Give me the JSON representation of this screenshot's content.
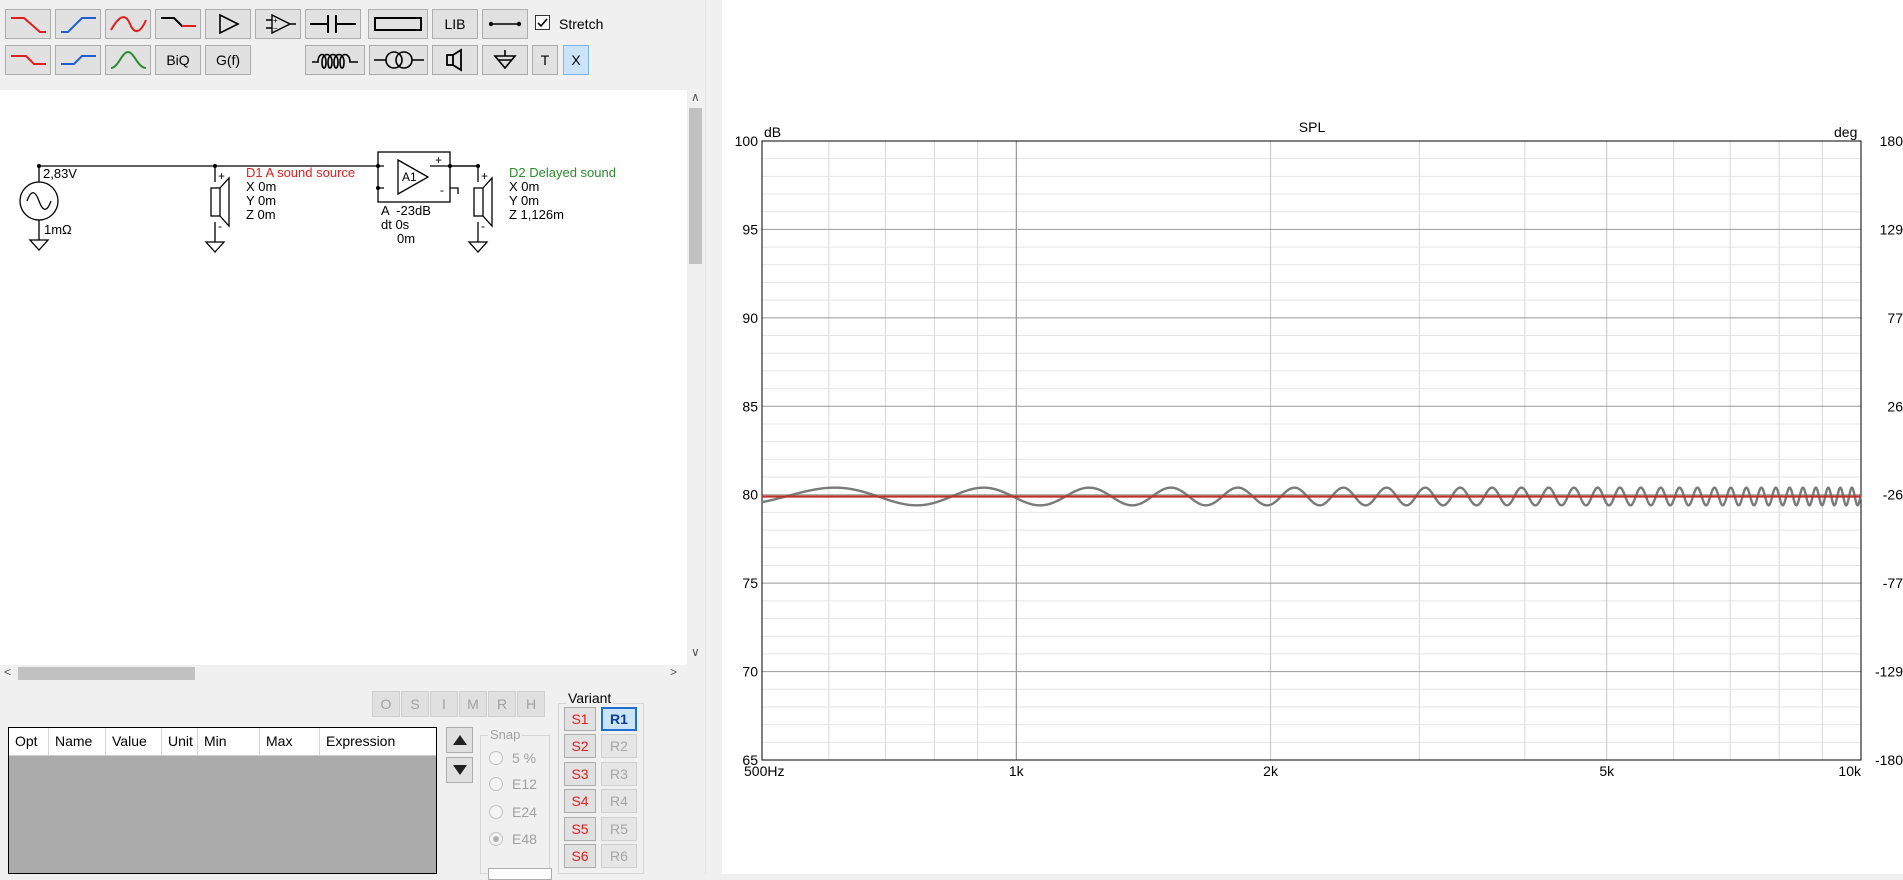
{
  "toolbar": {
    "biq_label": "BiQ",
    "gf_label": "G(f)",
    "lib_label": "LIB",
    "t_label": "T",
    "x_label": "X",
    "stretch_label": "Stretch",
    "stretch_checked": true
  },
  "schematic": {
    "source_voltage": "2,83V",
    "source_resistance": "1mΩ",
    "d1_name": "D1 A sound source",
    "d1_x": "X 0m",
    "d1_y": "Y 0m",
    "d1_z": "Z 0m",
    "amp_label": "A1",
    "amp_gain": "A  -23dB",
    "amp_dt": "dt 0s",
    "amp_dist": "0m",
    "d2_name": "D2 Delayed sound",
    "d2_x": "X 0m",
    "d2_y": "Y 0m",
    "d2_z": "Z 1,126m",
    "colors": {
      "d1": "#e0201c",
      "d2": "#2a8c2a"
    }
  },
  "opt_buttons": [
    "O",
    "S",
    "I",
    "M",
    "R",
    "H"
  ],
  "table": {
    "columns": [
      "Opt",
      "Name",
      "Value",
      "Unit",
      "Min",
      "Max",
      "Expression"
    ]
  },
  "snap": {
    "title": "Snap",
    "options": [
      "5 %",
      "E12",
      "E24",
      "E48"
    ],
    "selected": "E48"
  },
  "variant": {
    "title": "Variant",
    "s_buttons": [
      "S1",
      "S2",
      "S3",
      "S4",
      "S5",
      "S6"
    ],
    "r_buttons": [
      "R1",
      "R2",
      "R3",
      "R4",
      "R5",
      "R6"
    ],
    "active": "R1"
  },
  "chart_data": {
    "type": "line",
    "title": "SPL",
    "ylabel_left": "dB",
    "ylabel_right": "deg",
    "xscale": "log",
    "xlim": [
      500,
      10000
    ],
    "ylim": [
      65,
      100
    ],
    "y2lim": [
      -180,
      180
    ],
    "x_ticks": [
      {
        "v": 500,
        "label": "500Hz"
      },
      {
        "v": 1000,
        "label": "1k"
      },
      {
        "v": 2000,
        "label": "2k"
      },
      {
        "v": 5000,
        "label": "5k"
      },
      {
        "v": 10000,
        "label": "10k"
      }
    ],
    "y_ticks": [
      "100",
      "95",
      "90",
      "85",
      "80",
      "75",
      "70",
      "65"
    ],
    "y2_ticks": [
      "180",
      "129",
      "77",
      "26",
      "-26",
      "-77",
      "-129",
      "-180"
    ],
    "grid": true,
    "series": [
      {
        "color": "#c0302a",
        "style": "flat",
        "level_db": 79.9
      },
      {
        "color": "#7a7a7a",
        "style": "comb",
        "level_db": 79.9,
        "ripple_db": 0.5,
        "delay_ms": 3.28
      }
    ]
  }
}
